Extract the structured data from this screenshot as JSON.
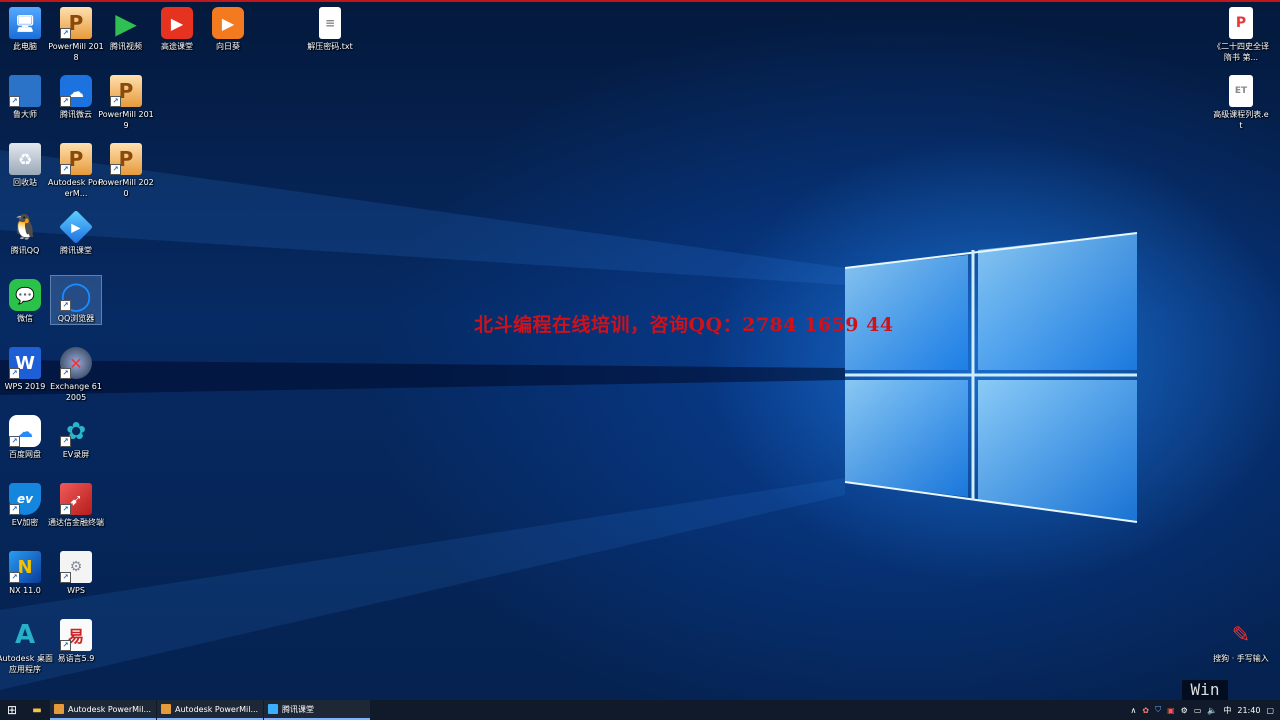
{
  "colors": {
    "accent": "#d0111a",
    "taskbar": "#101a2a",
    "desktop": "#062a63"
  },
  "watermark": "北斗编程在线培训，咨询QQ：2784 1659 44",
  "win_watermark": "Win",
  "icons": [
    {
      "label": "此电脑",
      "icon": "computer-icon"
    },
    {
      "label": "PowerMill 2018",
      "icon": "powermill-icon"
    },
    {
      "label": "腾讯视频",
      "icon": "tencent-video-icon"
    },
    {
      "label": "高途课堂",
      "icon": "gaotu-icon"
    },
    {
      "label": "向日葵",
      "icon": "sunflower-icon"
    },
    {
      "label": "解压密码.txt",
      "icon": "text-file-icon"
    },
    {
      "label": "鲁大师",
      "icon": "ludashi-icon"
    },
    {
      "label": "腾讯微云",
      "icon": "weiyun-icon"
    },
    {
      "label": "PowerMill 2019",
      "icon": "powermill-icon"
    },
    {
      "label": "回收站",
      "icon": "recycle-bin-icon"
    },
    {
      "label": "Autodesk PowerM...",
      "icon": "powermill-icon"
    },
    {
      "label": "PowerMill 2020",
      "icon": "powermill-icon"
    },
    {
      "label": "腾讯QQ",
      "icon": "qq-icon"
    },
    {
      "label": "腾讯课堂",
      "icon": "tencent-class-icon"
    },
    {
      "label": "微信",
      "icon": "wechat-icon"
    },
    {
      "label": "QQ浏览器",
      "icon": "qq-browser-icon"
    },
    {
      "label": "WPS 2019",
      "icon": "wps-icon"
    },
    {
      "label": "Exchange 612005",
      "icon": "exchange-icon"
    },
    {
      "label": "百度网盘",
      "icon": "baidu-netdisk-icon"
    },
    {
      "label": "EV录屏",
      "icon": "ev-record-icon"
    },
    {
      "label": "EV加密",
      "icon": "ev-encrypt-icon"
    },
    {
      "label": "通达信金融终端",
      "icon": "tdx-icon"
    },
    {
      "label": "NX 11.0",
      "icon": "nx-icon"
    },
    {
      "label": "WPS",
      "icon": "wps-file-icon"
    },
    {
      "label": "Autodesk 桌面应用程序",
      "icon": "autodesk-icon"
    },
    {
      "label": "易语言5.9",
      "icon": "eyuyan-icon"
    },
    {
      "label": "《二十四史全译 隋书 第...",
      "icon": "wps-pdf-icon"
    },
    {
      "label": "高级课程列表.et",
      "icon": "et-file-icon"
    },
    {
      "label": "搜狗 · 手写输入",
      "icon": "sogou-handwriting-icon"
    }
  ],
  "taskbar": {
    "tasks": [
      {
        "label": "Autodesk PowerMil...",
        "icon": "powermill-icon"
      },
      {
        "label": "Autodesk PowerMil...",
        "icon": "powermill-icon"
      },
      {
        "label": "腾讯课堂",
        "icon": "tencent-class-icon"
      }
    ],
    "ime": "中",
    "time": "21:40"
  }
}
